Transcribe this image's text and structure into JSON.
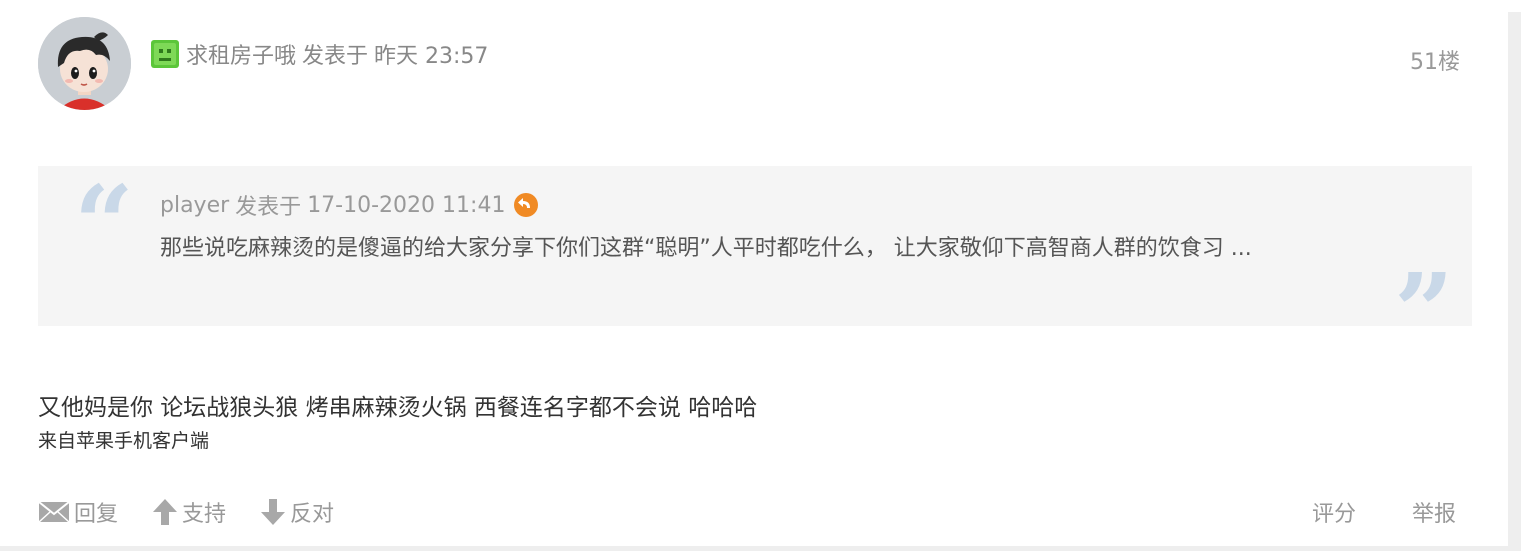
{
  "post": {
    "author": "求租房子哦",
    "posted_label": "发表于",
    "posted_time": "昨天 23:57",
    "floor": "51楼",
    "avatar_icon": "cartoon-face-icon",
    "level_icon": "green-face-icon"
  },
  "quote": {
    "author": "player",
    "posted_label": "发表于",
    "posted_time": "17-10-2020 11:41",
    "jump_icon": "orange-arrow-icon",
    "text": "那些说吃麻辣烫的是傻逼的给大家分享下你们这群“聪明”人平时都吃什么， 让大家敬仰下高智商人群的饮食习 ..."
  },
  "body": {
    "message": "又他妈是你 论坛战狼头狼 烤串麻辣烫火锅 西餐连名字都不会说 哈哈哈",
    "client": "来自苹果手机客户端"
  },
  "actions": {
    "reply": "回复",
    "support": "支持",
    "oppose": "反对",
    "rate": "评分",
    "report": "举报"
  },
  "colors": {
    "quote_bg": "#f5f5f5",
    "quote_mark": "#c9d8e8",
    "level_green": "#5cc63a",
    "jump_orange": "#f08a24",
    "muted_text": "#999999"
  }
}
